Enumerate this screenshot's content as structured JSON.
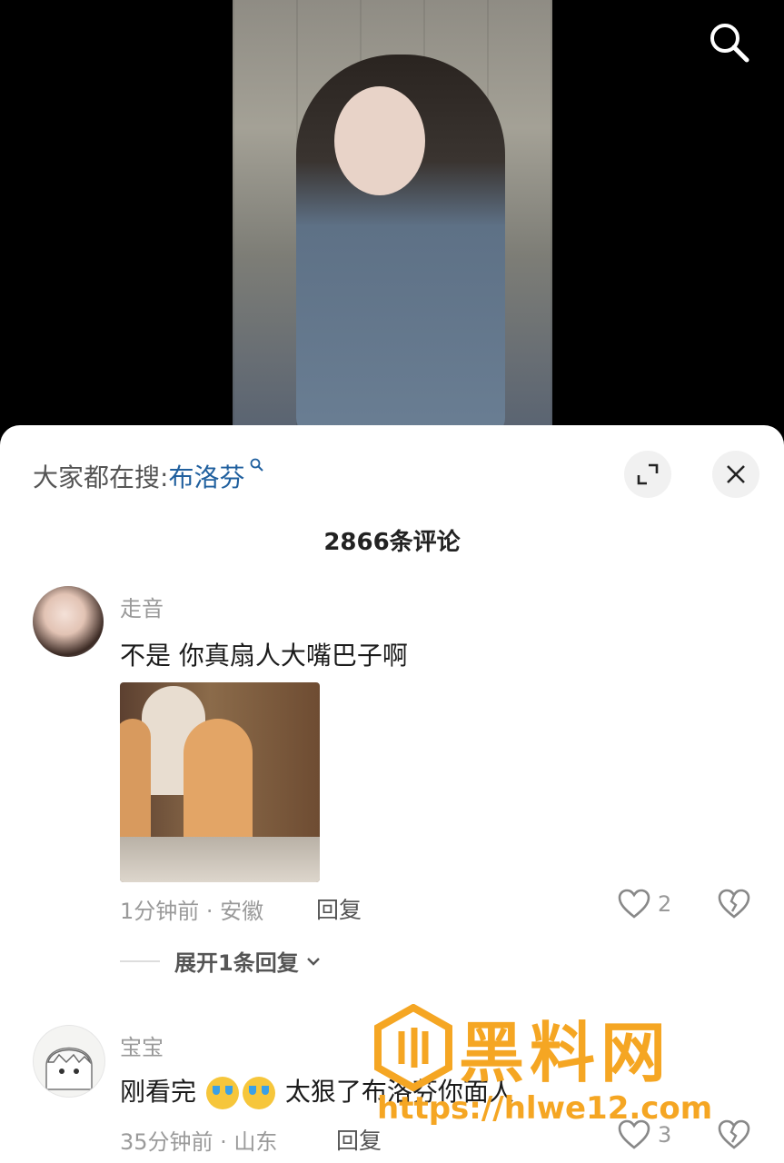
{
  "header": {
    "search_icon": "search-icon"
  },
  "hot_search": {
    "prefix": "大家都在搜:",
    "keyword": "布洛芬"
  },
  "controls": {
    "expand_icon": "expand-icon",
    "close_icon": "close-icon"
  },
  "comment_count": "2866条评论",
  "comments": [
    {
      "username": "走音",
      "text": "不是 你真扇人大嘴巴子啊",
      "time_location": "1分钟前 · 安徽",
      "reply_label": "回复",
      "likes": "2",
      "expand_replies": "展开1条回复"
    },
    {
      "username": "宝宝",
      "text_before": "刚看完",
      "text_after": "太狠了布洛芬你面人",
      "time_location": "35分钟前 · 山东",
      "reply_label": "回复",
      "likes": "3"
    }
  ],
  "watermark": {
    "title": "黑料网",
    "url": "https://hlwe12.com"
  },
  "colors": {
    "accent_link": "#1f5f9e",
    "watermark": "#f5a623"
  }
}
